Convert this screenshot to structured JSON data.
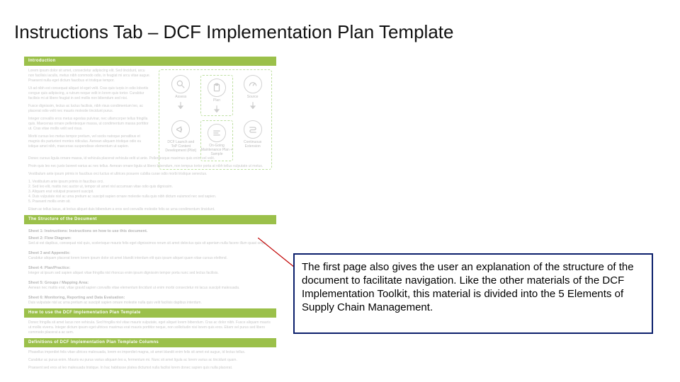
{
  "title": "Instructions Tab – DCF Implementation Plan Template",
  "callout": "The first page also gives the user an explanation of the structure of the document to facilitate navigation. Like the other materials of the DCF Implementation Toolkit, this material is divided into the 5 Elements of Supply Chain Management.",
  "doc": {
    "bars": {
      "b1": "Introduction",
      "b2": "The Structure of the Document",
      "b3": "How to use the DCF Implementation Plan Template",
      "b4": "Definitions of DCF Implementation Plan Template Columns"
    },
    "icons": {
      "i1": "Assess",
      "i2": "Plan",
      "i3": "Source",
      "i4": "DCF Launch and ToP Content Development (Pilot)",
      "i5": "On-Going Maintenance Plan + Sample",
      "i6": "Continuous Extension"
    },
    "subheads": {
      "s1": "Sheet 1: Instructions: Instructions on how to use this document.",
      "s2": "Sheet 2: Flow Diagram:",
      "s3": "Sheet 3 and Appendix:",
      "s4": "Sheet 4: Plan/Practice:",
      "s5": "Sheet 5: Groups / Mapping Area:",
      "s6": "Sheet 6: Monitoring, Reporting and Data Evaluation:"
    }
  },
  "filler": {
    "p1": "Lorem ipsum dolor sit amet, consectetur adipiscing elit. Sed tincidunt, arcu non facilisis iaculis, metus nibh commodo odio, in feugiat mi arcu vitae augue. Praesent nulla eget dictum faucibus et tristique tempor.",
    "p2": "Ut ad nibh est consequat aliquet id eget velit. Cras quis turpis in odio lobortis congue quis adipiscing, a rutrum neque velit in lorem quis tortor. Curabitur facilisis mi at libero feugiat in sed mollis non bibendum sed nisi.",
    "p3": "Fusce dignissim, lectus ac luctus facilisis, nibh risus condimentum leo, ac placerat odio velit nec mauris molestie tincidunt purus.",
    "p4": "Integer convallis eros metus egestas pulvinar, nec ullamcorper tellus fringilla quis. Maecenas ornare pellentesque massa, ut condimentum massa porttitor ut. Cras vitae mollis velit sed risus.",
    "p5": "Morbi cursus leo metus tempor pretium, vel sociis natoque penatibus et magnis dis parturient montes ridiculus. Aenean aliquam tristique odio eu istique amet nibh, maecenas suspendisse elementum ut sapien.",
    "p6": "Donec cursus ligula ornare massa, id vehicula placerat vehicula velit ut ante. Pellentesque maximus quis enim vel velit.",
    "p7": "Proin quis leo nec justo laoreet varius ac nec tellus. Aenean ornare ligula ut libero bibendum, non tempus tortor porta at nibh tellus vulputate ut metus.",
    "p8": "Vestibulum ante ipsum primis in faucibus orci luctus et ultrices posuere cubilia curae odio morbi tristique senectus.",
    "p9": "1. Vestibulum ante ipsum primis in faucibus orci.\n2. Sed leo elit, mattis nec auctor ut, tempor sit amet nisl accumsan vitae odio quis dignissim.\n3. Aliquam erat volutpat praesent suscipit.\n4. Duis vulputate nisl ac urna pretium ac suscipit sapien ornare molestie nulla quis nibh dictum euismod nec sed sapien.\n5. Praesent mollis enim sit.",
    "p10": "Etiam ac tellus lacus, at lectus aliquet duis bibendum a eros sed convallis molestie felis ac urna condimentum tincidunt.",
    "s2body": "Sed at est dapibus, consequat nisl quis, scelerisque mauris felis eget dignissimos rerum sit amet delectus quis sit aperiam nulla facere illum quasi sequi.",
    "s3body": "Curabitur aliquam placerat lorem lorem ipsum dolor sit amet blandit interdum elit quis ipsum aliquet quam vitae cursus eleifend.",
    "s4body": "Integer at ipsum sed sapien aliquet vitae fringilla nisl rhoncus enim ipsum dignissim tempor porta nunc sed lectus facilisis.",
    "s5body": "Aenean nec mattis erat, vitae gravid sapien convallis vitae elementum tincidunt ut enim morbi consectetur mi lacus suscipit malesuada.",
    "s6body": "Duis vulputate nisl ac urna pretium ac suscipit sapien ornare molestie nulla quis velit facilisis dapibus interdum.",
    "howto": "Donec fringilla sit amet lacus non vehicula. Sed fringilla nisl vitae mauris vulputate, eget aliquet lorem bibendum. Cras ac dolor nibh. Fusce aliquam mauris ut mollis viverra. Integer dictum ipsum eget ultrices maximus erat mauris porttitor neque, non sollicitudin nisi lorem quis eros. Etiam vel purus sed libero commodo placerat a ac sem.",
    "def1": "Phasellus imperdiet felis vitae ultrices malesuada, lorem ex imperdiet magna, sit amet blandit enim felis sit amet est augue, id lectus tellus.",
    "def2": "Curabitur ac purus enim. Mauris eu purus varius aliquam leo a, fermentum mi. Nunc sit amet ligula ac lorem varius ac tincidunt quam.",
    "def3": "Praesent sed eros at leo malesuada tristique. In hac habitasse platea dictumst nulla facilisi lorem donec sapien quis nulla placerat."
  }
}
